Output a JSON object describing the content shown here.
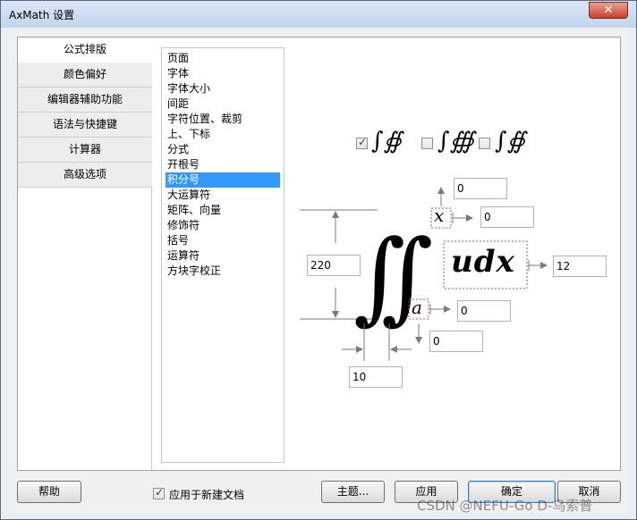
{
  "window": {
    "title": "AxMath 设置",
    "close_glyph": "✕"
  },
  "nav": {
    "items": [
      {
        "label": "公式排版",
        "active": true
      },
      {
        "label": "颜色偏好",
        "active": false
      },
      {
        "label": "编辑器辅助功能",
        "active": false
      },
      {
        "label": "语法与快捷键",
        "active": false
      },
      {
        "label": "计算器",
        "active": false
      },
      {
        "label": "高级选项",
        "active": false
      }
    ]
  },
  "categories": {
    "items": [
      "页面",
      "字体",
      "字体大小",
      "间距",
      "字符位置、裁剪",
      "上、下标",
      "分式",
      "开根号",
      "积分号",
      "大运算符",
      "矩阵、向量",
      "修饰符",
      "括号",
      "运算符",
      "方块字校正"
    ],
    "selected": "积分号"
  },
  "integral": {
    "style_options": [
      {
        "checked": true,
        "glyphs": "∫∯"
      },
      {
        "checked": false,
        "glyphs": "∫∰"
      },
      {
        "checked": false,
        "glyphs": "∫∯"
      }
    ],
    "upper_offset_y": "0",
    "upper_offset_x": "0",
    "size": "220",
    "body_spacing": "12",
    "lower_offset_x": "0",
    "lower_offset_y": "0",
    "gap": "10",
    "preview": {
      "upper_limit": "x",
      "lower_limit": "a",
      "integrand": "udx"
    }
  },
  "footer": {
    "help": "帮助",
    "apply_new_doc": "应用于新建文档",
    "apply_new_doc_checked": true,
    "theme": "主题...",
    "apply": "应用",
    "ok": "确定",
    "cancel": "取消"
  },
  "watermark": "CSDN @NEFU-Go D-乌索普",
  "colors": {
    "selection": "#3399ff",
    "arrow": "#7a7a7a",
    "guide": "#b44a8a"
  }
}
